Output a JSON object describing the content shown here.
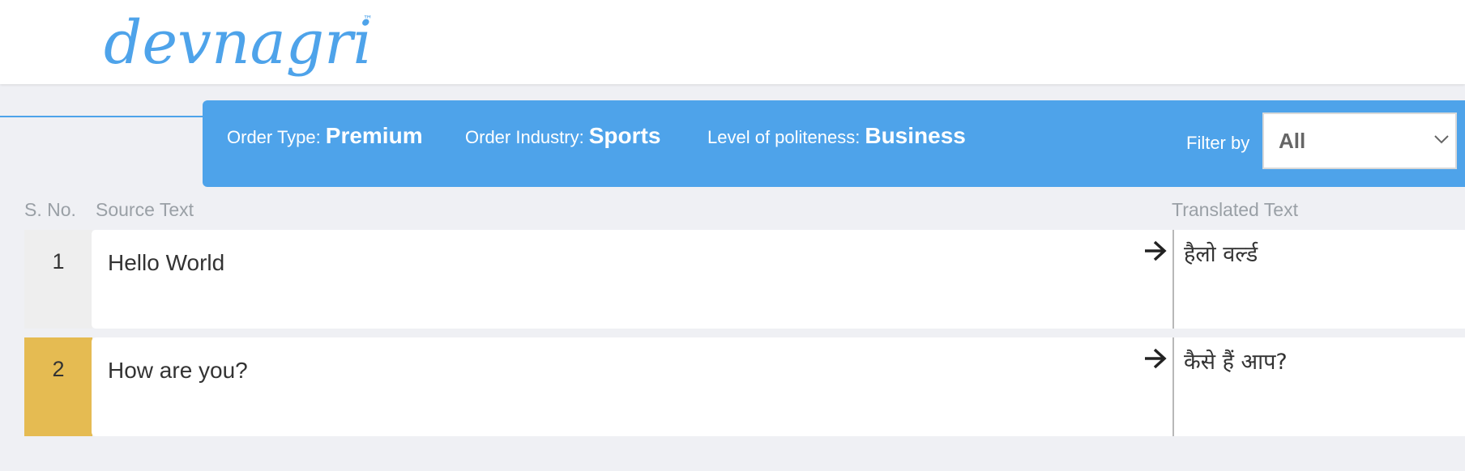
{
  "brand": {
    "logo_text": "devnagri",
    "trademark": "™",
    "logo_color": "#4ea3ea"
  },
  "order_info": {
    "type_label": "Order Type:",
    "type_value": "Premium",
    "industry_label": "Order Industry:",
    "industry_value": "Sports",
    "politeness_label": "Level of politeness:",
    "politeness_value": "Business",
    "bar_color": "#4ea3ea"
  },
  "filter": {
    "label": "Filter by",
    "selected": "All",
    "icon": "chevron-down-icon"
  },
  "columns": {
    "sno": "S. No.",
    "source": "Source Text",
    "translated": "Translated Text"
  },
  "rows": [
    {
      "sno": "1",
      "source": "Hello World",
      "translated": "हैलो वर्ल्ड",
      "active": false
    },
    {
      "sno": "2",
      "source": "How are you?",
      "translated": "कैसे हैं आप?",
      "active": true
    }
  ],
  "colors": {
    "active_row_marker": "#e5bb52",
    "background": "#eff0f4"
  }
}
